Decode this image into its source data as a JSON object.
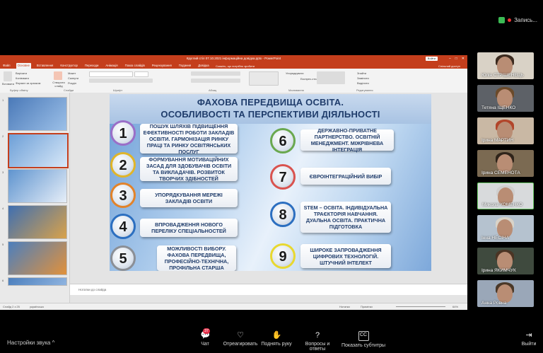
{
  "meeting": {
    "recording_label": "Запись...",
    "sound_settings": "Настройки звука",
    "caret": "^"
  },
  "toolbar": {
    "chat": "Чат",
    "chat_badge": "37",
    "react": "Отреагировать",
    "raise_hand": "Поднять руку",
    "qa": "Вопросы и ответы",
    "subtitles": "Показать субтитры",
    "leave": "Выйти"
  },
  "powerpoint": {
    "window_title": "Круглий стіл 07.10.2021 інформаційна довідка.pptx - PowerPoint",
    "account_button": "Войти",
    "share_label": "Спільний доступ",
    "search_hint": "Скажіть, що потрібно зробити",
    "tabs": [
      "Файл",
      "Основне",
      "Вставлення",
      "Конструктор",
      "Переходи",
      "Анімація",
      "Показ слайдів",
      "Рецензування",
      "Подання",
      "Довідка"
    ],
    "ribbon_groups": [
      "Буфер обміну",
      "Слайди",
      "Шрифт",
      "Абзац",
      "Малювання",
      "Редагування"
    ],
    "ribbon_items": {
      "paste": "Вставити",
      "cut": "Вирізати",
      "copy": "Копіювати",
      "format_painter": "Формат за зразком",
      "new_slide": "Створити слайд",
      "layout": "Макет",
      "reset": "Скинути",
      "section": "Розділ",
      "arrange": "Упорядкувати",
      "quick_styles": "Експрес-стилі",
      "find": "Знайти",
      "replace": "Замінити",
      "select": "Виділити"
    },
    "notes_placeholder": "Нотатки до слайда",
    "status_left": "Слайд 2 з 25",
    "status_lang": "українська",
    "status_notes": "Нотатки",
    "status_comments": "Примітки",
    "zoom": "64%",
    "slide_numbers": [
      "1",
      "2",
      "3",
      "4",
      "5",
      "6"
    ]
  },
  "slide": {
    "title_line1": "ФАХОВА ПЕРЕДВИЩА ОСВІТА.",
    "title_line2": "ОСОБЛИВОСТІ ТА ПЕРСПЕКТИВИ ДІЯЛЬНОСТІ",
    "items": [
      {
        "num": "1",
        "ring": "#9a6fc8",
        "text": "ПОШУК ШЛЯХІВ ПІДВИЩЕННЯ ЕФЕКТИВНОСТІ РОБОТИ ЗАКЛАДІВ ОСВІТИ. ГАРМОНІЗАЦІЯ РИНКУ ПРАЦІ ТА РИНКУ ОСВІТЯНСЬКИХ ПОСЛУГ"
      },
      {
        "num": "2",
        "ring": "#e0b52a",
        "text": "ФОРМУВАННЯ МОТИВАЦІЙНИХ ЗАСАД ДЛЯ ЗДОБУВАЧІВ ОСВІТИ ТА ВИКЛАДАЧІВ. РОЗВИТОК ТВОРЧИХ ЗДІБНОСТЕЙ"
      },
      {
        "num": "3",
        "ring": "#e2832a",
        "text": "УПОРЯДКУВАННЯ МЕРЕЖІ ЗАКЛАДІВ ОСВІТИ"
      },
      {
        "num": "4",
        "ring": "#2c6fc0",
        "text": "ВПРОВАДЖЕННЯ НОВОГО ПЕРЕЛІКУ СПЕЦІАЛЬНОСТЕЙ"
      },
      {
        "num": "5",
        "ring": "#8b8f96",
        "text": "МОЖЛИВОСТІ ВИБОРУ. ФАХОВА ПЕРЕДВИЩА, ПРОФЕСІЙНО-ТЕХНІЧНА, ПРОФІЛЬНА СТАРША"
      },
      {
        "num": "6",
        "ring": "#6aa84f",
        "text": "ДЕРЖАВНО-ПРИВАТНЕ ПАРТНЕРСТВО. ОСВІТНІЙ МЕНЕДЖМЕНТ. МІЖРІВНЕВА ІНТЕГРАЦІЯ"
      },
      {
        "num": "7",
        "ring": "#d9534f",
        "text": "ЄВРОІНТЕГРАЦІЙНИЙ ВИБІР"
      },
      {
        "num": "8",
        "ring": "#2c6fc0",
        "text": "STEM – ОСВІТА. ІНДИВІДУАЛЬНА ТРАЄКТОРІЯ НАВЧАННЯ. ДУАЛЬНА ОСВІТА. ПРАКТИЧНА ПІДГОТОВКА"
      },
      {
        "num": "9",
        "ring": "#e8d830",
        "text": "ШИРОКЕ ЗАПРОВАДЖЕННЯ ЦИФРОВИХ ТЕХНОЛОГІЙ. ШТУЧНИЙ ІНТЕЛЕКТ"
      }
    ]
  },
  "participants": [
    {
      "name": "Юлія СТРІШЕНЕЦЬ",
      "bg": "#d9d2c6",
      "hair": "#3b2a1e"
    },
    {
      "name": "Тетяна ІЩЕНКО",
      "bg": "#5d6167",
      "hair": "#6b4a2a"
    },
    {
      "name": "Ірина МАРТИН",
      "bg": "#c9b8a4",
      "hair": "#b2452a"
    },
    {
      "name": "Ірина СЕМЕНОТА",
      "bg": "#7b6a52",
      "hair": "#2f241a"
    },
    {
      "name": "Микола ХОМЕНКО",
      "bg": "#d8dadc",
      "hair": "#cfcfcf"
    },
    {
      "name": "Інна НЕСІНА",
      "bg": "#b5c2cf",
      "hair": "#d9d3c8"
    },
    {
      "name": "Ірина ЯКИМЧУК",
      "bg": "#3f4a3e",
      "hair": "#4b3424"
    },
    {
      "name": "Анна Ровна",
      "bg": "#9aa7b8",
      "hair": "#4a3828"
    }
  ]
}
